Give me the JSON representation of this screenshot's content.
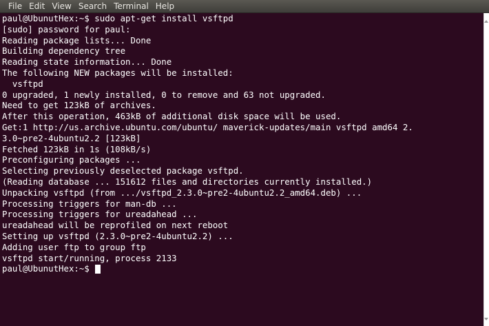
{
  "menu": [
    "File",
    "Edit",
    "View",
    "Search",
    "Terminal",
    "Help"
  ],
  "terminal": {
    "lines": [
      "paul@UbunutHex:~$ sudo apt-get install vsftpd",
      "[sudo] password for paul:",
      "Reading package lists... Done",
      "Building dependency tree",
      "Reading state information... Done",
      "The following NEW packages will be installed:",
      "  vsftpd",
      "0 upgraded, 1 newly installed, 0 to remove and 63 not upgraded.",
      "Need to get 123kB of archives.",
      "After this operation, 463kB of additional disk space will be used.",
      "Get:1 http://us.archive.ubuntu.com/ubuntu/ maverick-updates/main vsftpd amd64 2.",
      "3.0~pre2-4ubuntu2.2 [123kB]",
      "Fetched 123kB in 1s (108kB/s)",
      "Preconfiguring packages ...",
      "Selecting previously deselected package vsftpd.",
      "(Reading database ... 151612 files and directories currently installed.)",
      "Unpacking vsftpd (from .../vsftpd_2.3.0~pre2-4ubuntu2.2_amd64.deb) ...",
      "Processing triggers for man-db ...",
      "Processing triggers for ureadahead ...",
      "ureadahead will be reprofiled on next reboot",
      "Setting up vsftpd (2.3.0~pre2-4ubuntu2.2) ...",
      "Adding user ftp to group ftp",
      "vsftpd start/running, process 2133"
    ],
    "prompt": "paul@UbunutHex:~$ "
  },
  "colors": {
    "background": "#2c0a1f",
    "text": "#ffffff",
    "menubar": "#4a4944"
  }
}
